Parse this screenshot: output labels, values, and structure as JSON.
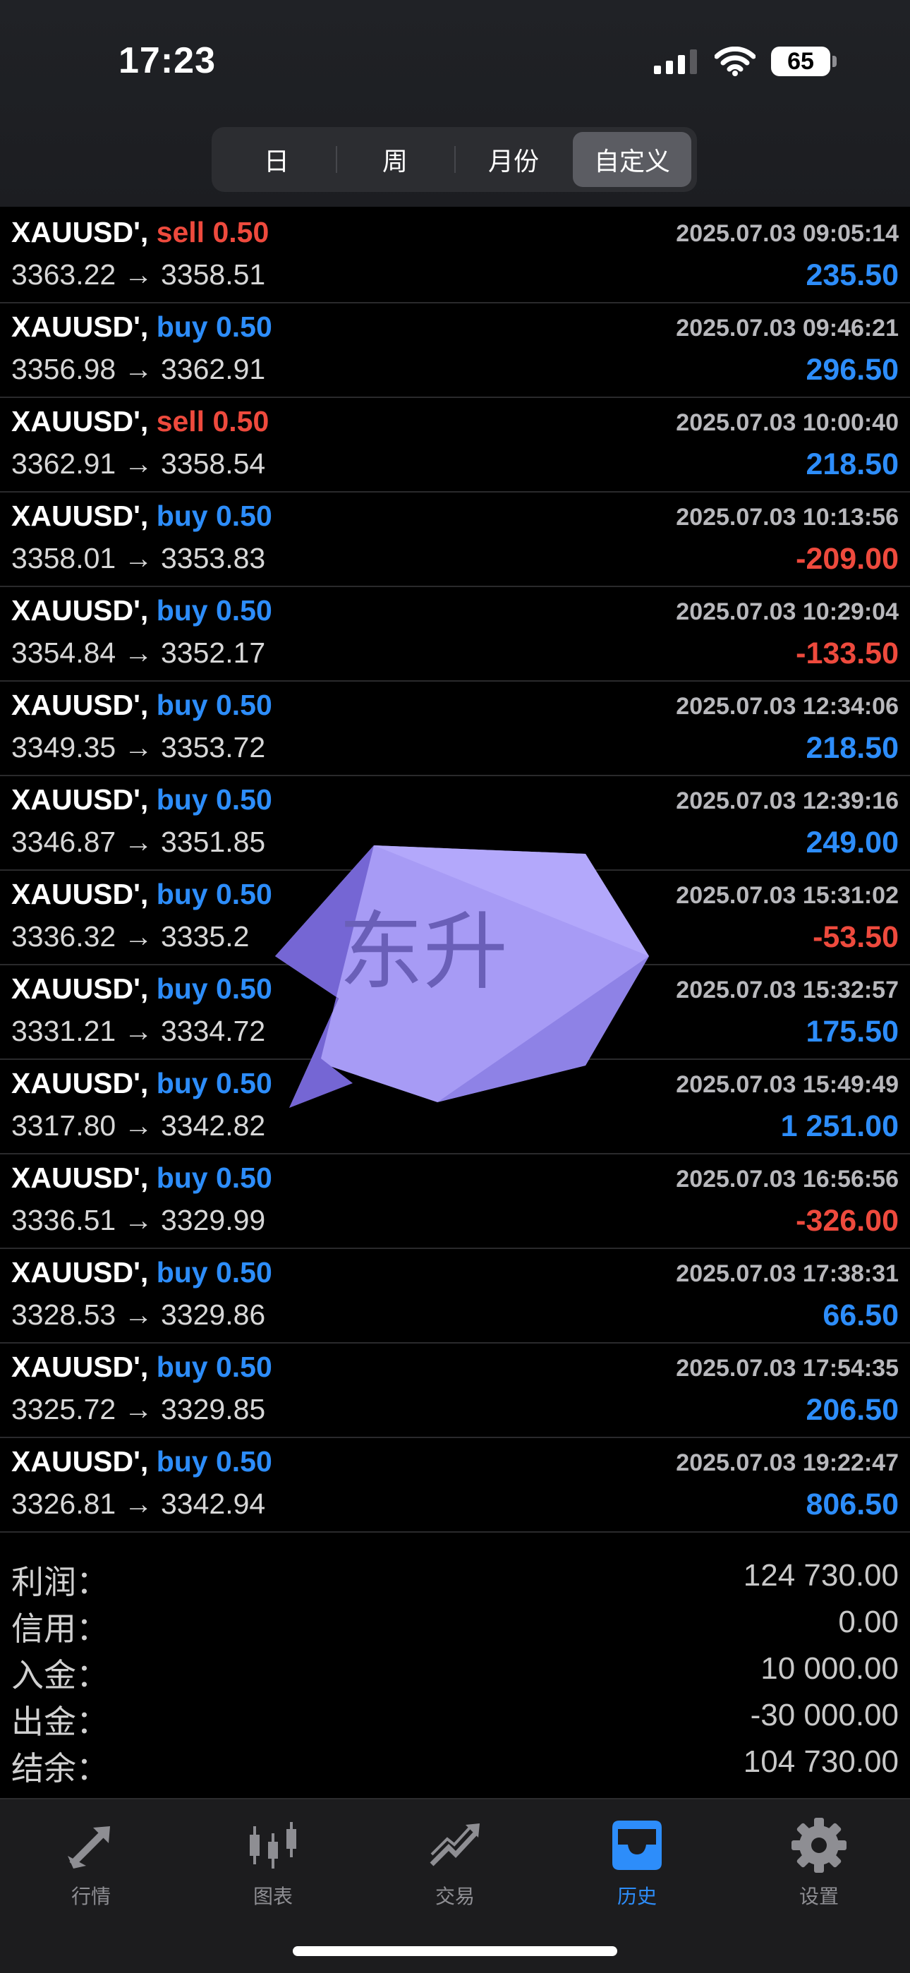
{
  "status_bar": {
    "time": "17:23",
    "battery": "65"
  },
  "segments": [
    {
      "label": "日",
      "active": false
    },
    {
      "label": "周",
      "active": false
    },
    {
      "label": "月份",
      "active": false
    },
    {
      "label": "自定义",
      "active": true
    }
  ],
  "trades": [
    {
      "symbol": "XAUUSD',",
      "side": "sell",
      "volume": "sell 0.50",
      "time": "2025.07.03 09:05:14",
      "prices": "3363.22 → 3358.51",
      "profit": "235.50",
      "positive": true
    },
    {
      "symbol": "XAUUSD',",
      "side": "buy",
      "volume": "buy 0.50",
      "time": "2025.07.03 09:46:21",
      "prices": "3356.98 → 3362.91",
      "profit": "296.50",
      "positive": true
    },
    {
      "symbol": "XAUUSD',",
      "side": "sell",
      "volume": "sell 0.50",
      "time": "2025.07.03 10:00:40",
      "prices": "3362.91 → 3358.54",
      "profit": "218.50",
      "positive": true
    },
    {
      "symbol": "XAUUSD',",
      "side": "buy",
      "volume": "buy 0.50",
      "time": "2025.07.03 10:13:56",
      "prices": "3358.01 → 3353.83",
      "profit": "-209.00",
      "positive": false
    },
    {
      "symbol": "XAUUSD',",
      "side": "buy",
      "volume": "buy 0.50",
      "time": "2025.07.03 10:29:04",
      "prices": "3354.84 → 3352.17",
      "profit": "-133.50",
      "positive": false
    },
    {
      "symbol": "XAUUSD',",
      "side": "buy",
      "volume": "buy 0.50",
      "time": "2025.07.03 12:34:06",
      "prices": "3349.35 → 3353.72",
      "profit": "218.50",
      "positive": true
    },
    {
      "symbol": "XAUUSD',",
      "side": "buy",
      "volume": "buy 0.50",
      "time": "2025.07.03 12:39:16",
      "prices": "3346.87 → 3351.85",
      "profit": "249.00",
      "positive": true
    },
    {
      "symbol": "XAUUSD',",
      "side": "buy",
      "volume": "buy 0.50",
      "time": "2025.07.03 15:31:02",
      "prices": "3336.32 → 3335.2",
      "profit": "-53.50",
      "positive": false
    },
    {
      "symbol": "XAUUSD',",
      "side": "buy",
      "volume": "buy 0.50",
      "time": "2025.07.03 15:32:57",
      "prices": "3331.21 → 3334.72",
      "profit": "175.50",
      "positive": true
    },
    {
      "symbol": "XAUUSD',",
      "side": "buy",
      "volume": "buy 0.50",
      "time": "2025.07.03 15:49:49",
      "prices": "3317.80 → 3342.82",
      "profit": "1 251.00",
      "positive": true
    },
    {
      "symbol": "XAUUSD',",
      "side": "buy",
      "volume": "buy 0.50",
      "time": "2025.07.03 16:56:56",
      "prices": "3336.51 → 3329.99",
      "profit": "-326.00",
      "positive": false
    },
    {
      "symbol": "XAUUSD',",
      "side": "buy",
      "volume": "buy 0.50",
      "time": "2025.07.03 17:38:31",
      "prices": "3328.53 → 3329.86",
      "profit": "66.50",
      "positive": true
    },
    {
      "symbol": "XAUUSD',",
      "side": "buy",
      "volume": "buy 0.50",
      "time": "2025.07.03 17:54:35",
      "prices": "3325.72 → 3329.85",
      "profit": "206.50",
      "positive": true
    },
    {
      "symbol": "XAUUSD',",
      "side": "buy",
      "volume": "buy 0.50",
      "time": "2025.07.03 19:22:47",
      "prices": "3326.81 → 3342.94",
      "profit": "806.50",
      "positive": true
    }
  ],
  "summary": [
    {
      "label": "利润：",
      "value": "124 730.00"
    },
    {
      "label": "信用：",
      "value": "0.00"
    },
    {
      "label": "入金：",
      "value": "10 000.00"
    },
    {
      "label": "出金：",
      "value": "-30 000.00"
    },
    {
      "label": "结余：",
      "value": "104 730.00"
    }
  ],
  "watermark": {
    "text": "东升"
  },
  "tabs": [
    {
      "label": "行情",
      "icon": "quotes-icon",
      "active": false
    },
    {
      "label": "图表",
      "icon": "chart-icon",
      "active": false
    },
    {
      "label": "交易",
      "icon": "trade-icon",
      "active": false
    },
    {
      "label": "历史",
      "icon": "history-icon",
      "active": true
    },
    {
      "label": "设置",
      "icon": "settings-icon",
      "active": false
    }
  ],
  "colors": {
    "buy": "#2d8dfa",
    "sell": "#ee4a3d",
    "accent": "#2d8dfa",
    "watermark": "#a79bf5"
  }
}
